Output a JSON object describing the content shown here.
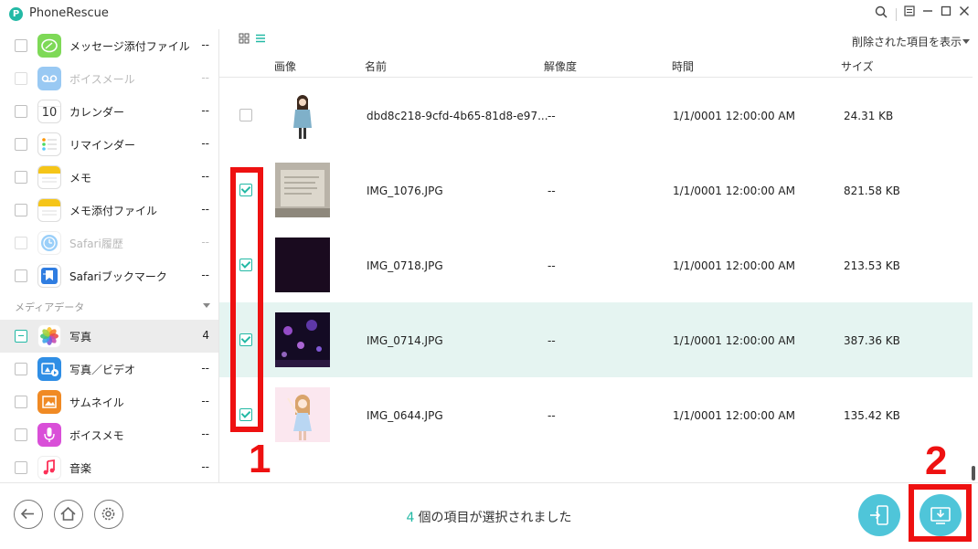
{
  "app": {
    "title": "PhoneRescue"
  },
  "sidebar": {
    "items": [
      {
        "label": "メッセージ添付ファイル",
        "count": "--",
        "icon": "message-attachment-icon",
        "color": "#7ed957"
      },
      {
        "label": "ボイスメール",
        "count": "--",
        "icon": "voicemail-icon",
        "color": "#1e88e5"
      },
      {
        "label": "カレンダー",
        "count": "--",
        "icon": "calendar-icon",
        "date": "10"
      },
      {
        "label": "リマインダー",
        "count": "--",
        "icon": "reminder-icon"
      },
      {
        "label": "メモ",
        "count": "--",
        "icon": "notes-icon",
        "color": "#f5c518"
      },
      {
        "label": "メモ添付ファイル",
        "count": "--",
        "icon": "notes-attachment-icon",
        "color": "#f5c518"
      },
      {
        "label": "Safari履歴",
        "count": "--",
        "icon": "safari-history-icon",
        "color": "#2196f3"
      },
      {
        "label": "Safariブックマーク",
        "count": "--",
        "icon": "safari-bookmark-icon",
        "color": "#2f7de1"
      }
    ],
    "section_label": "メディアデータ",
    "media_items": [
      {
        "label": "写真",
        "count": "4",
        "icon": "photos-icon"
      },
      {
        "label": "写真／ビデオ",
        "count": "--",
        "icon": "photo-video-icon",
        "color": "#2f8ee5"
      },
      {
        "label": "サムネイル",
        "count": "--",
        "icon": "thumbnail-icon",
        "color": "#f08a24"
      },
      {
        "label": "ボイスメモ",
        "count": "--",
        "icon": "voice-memo-icon",
        "color": "#d94fd8"
      },
      {
        "label": "音楽",
        "count": "--",
        "icon": "music-icon",
        "color": "#fc3158"
      }
    ]
  },
  "toolbar": {
    "show_deleted": "削除された項目を表示"
  },
  "table": {
    "headers": {
      "image": "画像",
      "name": "名前",
      "resolution": "解像度",
      "time": "時間",
      "size": "サイズ"
    },
    "rows": [
      {
        "name": "dbd8c218-9cfd-4b65-81d8-e97...",
        "resolution": "--",
        "time": "1/1/0001 12:00:00 AM",
        "size": "24.31 KB",
        "checked": false
      },
      {
        "name": "IMG_1076.JPG",
        "resolution": "--",
        "time": "1/1/0001 12:00:00 AM",
        "size": "821.58 KB",
        "checked": true
      },
      {
        "name": "IMG_0718.JPG",
        "resolution": "--",
        "time": "1/1/0001 12:00:00 AM",
        "size": "213.53 KB",
        "checked": true
      },
      {
        "name": "IMG_0714.JPG",
        "resolution": "--",
        "time": "1/1/0001 12:00:00 AM",
        "size": "387.36 KB",
        "checked": true
      },
      {
        "name": "IMG_0644.JPG",
        "resolution": "--",
        "time": "1/1/0001 12:00:00 AM",
        "size": "135.42 KB",
        "checked": true
      }
    ]
  },
  "status": {
    "count": "4",
    "text": "個の項目が選択されました"
  },
  "annotations": {
    "one": "1",
    "two": "2"
  },
  "colors": {
    "accent": "#23b9a5",
    "highlight_row": "#e5f4f1",
    "annotation_red": "#ee1111"
  }
}
